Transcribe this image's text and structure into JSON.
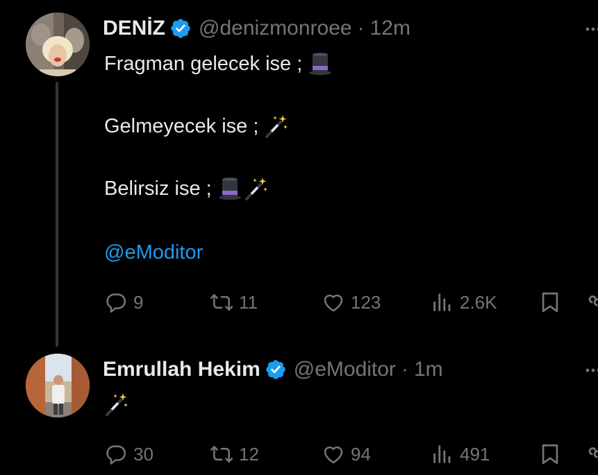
{
  "tweets": [
    {
      "name": "DENİZ",
      "handle": "@denizmonroee",
      "separator": "·",
      "time": "12m",
      "lines": [
        "Fragman gelecek ise ;",
        "Gelmeyecek ise ;",
        "Belirsiz ise ;"
      ],
      "mention": "@eModitor",
      "emojis": [
        "top-hat-icon",
        "magic-wand-icon"
      ],
      "stats": {
        "replies": "9",
        "retweets": "11",
        "likes": "123",
        "views": "2.6K"
      }
    },
    {
      "name": "Emrullah Hekim",
      "handle": "@eModitor",
      "separator": "·",
      "time": "1m",
      "emojis": [
        "magic-wand-icon"
      ],
      "stats": {
        "replies": "30",
        "retweets": "12",
        "likes": "94",
        "views": "491"
      }
    }
  ],
  "colors": {
    "background": "#000000",
    "text": "#e7e9ea",
    "muted": "#71767b",
    "accent": "#1d9bf0",
    "thread_line": "#333639"
  }
}
